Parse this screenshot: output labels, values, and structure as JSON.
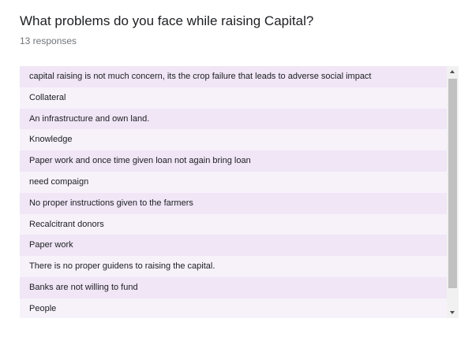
{
  "question": {
    "title": "What problems do you face while raising Capital?",
    "response_count": "13 responses"
  },
  "responses": [
    "capital raising is not much concern, its the crop failure that leads to adverse social impact",
    "Collateral",
    "An infrastructure and own land.",
    "Knowledge",
    "Paper work and once time given loan not again bring loan",
    "need compaign",
    "No proper instructions given to the farmers",
    "Recalcitrant donors",
    "Paper work",
    "There is no proper guidens to raising the capital.",
    "Banks are not willing to fund",
    "People"
  ],
  "colors": {
    "row_odd": "#f0e6f6",
    "row_even": "#f7f2fa",
    "text": "#202124",
    "subtext": "#70757a"
  },
  "scrollbar": {
    "icons": [
      "chevron-up-icon",
      "chevron-down-icon"
    ]
  }
}
